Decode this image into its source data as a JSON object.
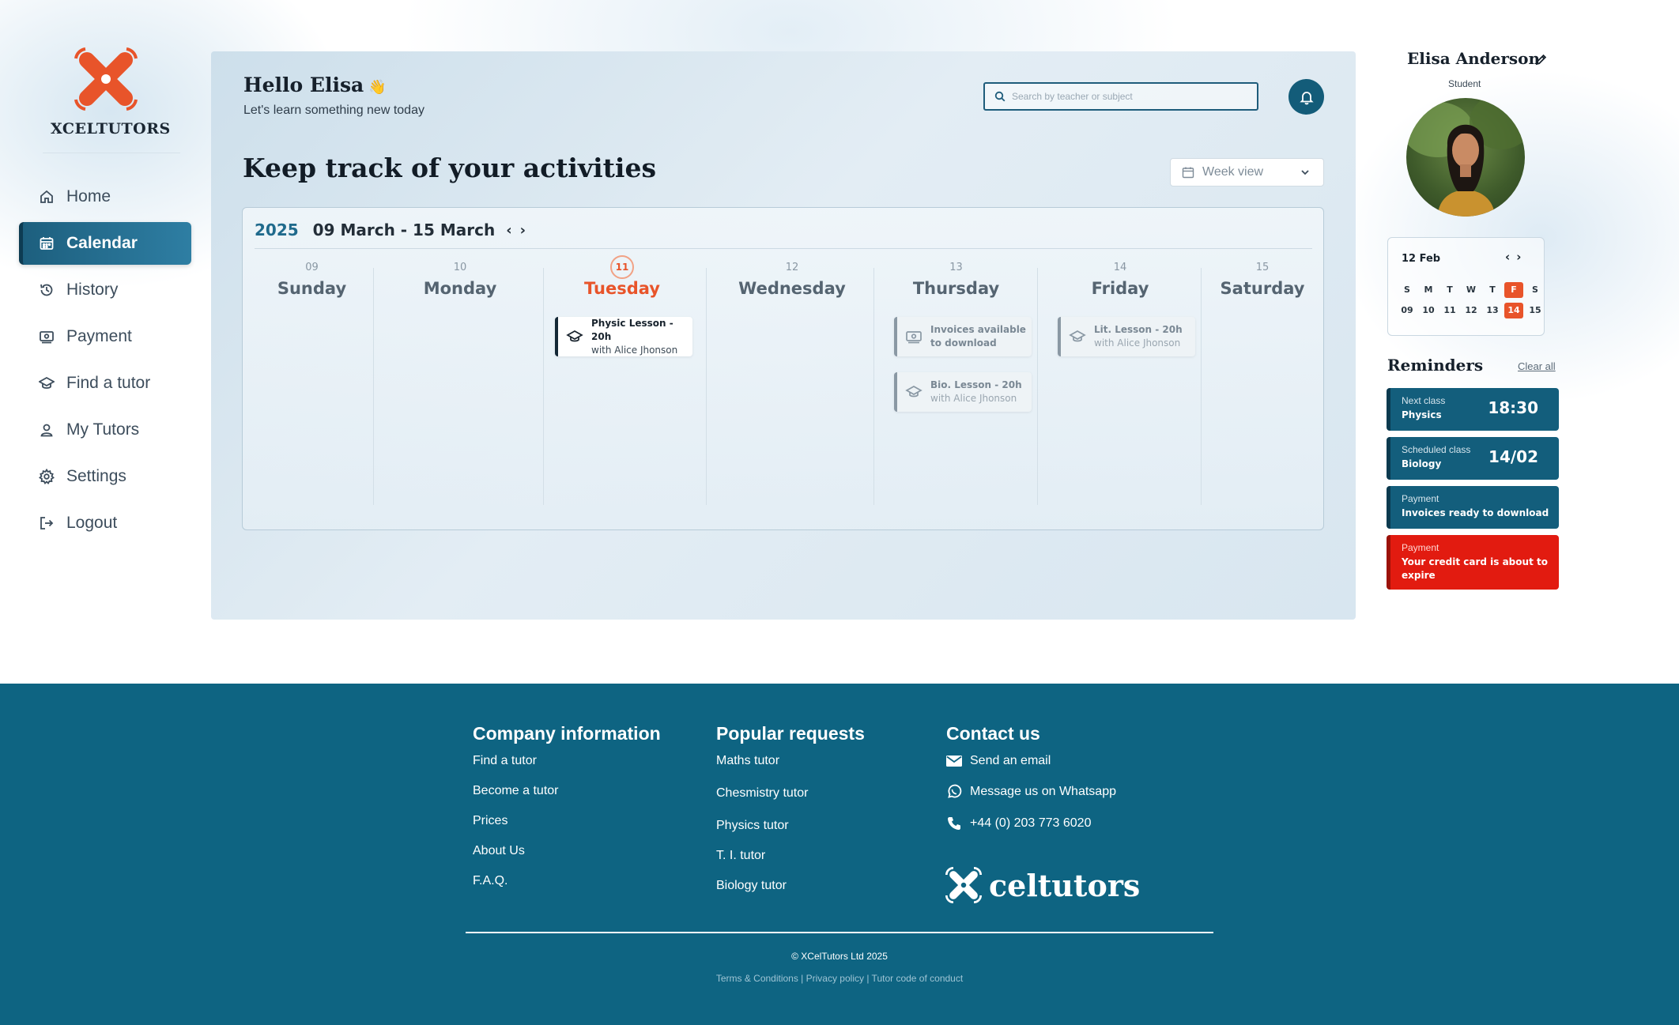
{
  "brand": {
    "name": "XCELTUTORS",
    "accent": "#e8542a",
    "primary": "#135e7c"
  },
  "sidebar": {
    "items": [
      {
        "label": "Home",
        "icon": "home-icon"
      },
      {
        "label": "Calendar",
        "icon": "calendar-icon",
        "active": true
      },
      {
        "label": "History",
        "icon": "history-icon"
      },
      {
        "label": "Payment",
        "icon": "payment-icon"
      },
      {
        "label": "Find a tutor",
        "icon": "graduation-cap-icon"
      },
      {
        "label": "My Tutors",
        "icon": "user-icon"
      },
      {
        "label": "Settings",
        "icon": "gear-icon"
      },
      {
        "label": "Logout",
        "icon": "logout-icon"
      }
    ]
  },
  "header": {
    "greeting": "Hello Elisa",
    "greeting_emoji": "👋",
    "subtitle": "Let's learn something new today",
    "search_placeholder": "Search by teacher or subject"
  },
  "main": {
    "title": "Keep track of your activities",
    "view_select": "Week view"
  },
  "calendar": {
    "year": "2025",
    "range": "09 March - 15 March",
    "days": [
      {
        "num": "09",
        "name": "Sunday"
      },
      {
        "num": "10",
        "name": "Monday"
      },
      {
        "num": "11",
        "name": "Tuesday",
        "today": true
      },
      {
        "num": "12",
        "name": "Wednesday"
      },
      {
        "num": "13",
        "name": "Thursday"
      },
      {
        "num": "14",
        "name": "Friday"
      },
      {
        "num": "15",
        "name": "Saturday"
      }
    ],
    "events": [
      {
        "title": "Physic Lesson - 20h",
        "sub": "with Alice Jhonson",
        "day": "Tuesday"
      },
      {
        "title": "Invoices available",
        "sub": "to download",
        "day": "Thursday"
      },
      {
        "title": "Bio. Lesson - 20h",
        "sub": "with Alice Jhonson",
        "day": "Thursday"
      },
      {
        "title": "Lit. Lesson - 20h",
        "sub": "with Alice Jhonson",
        "day": "Friday"
      }
    ]
  },
  "profile": {
    "name": "Elisa Anderson",
    "role": "Student"
  },
  "mini_calendar": {
    "title": "12 Feb",
    "weekdays": [
      "S",
      "M",
      "T",
      "W",
      "T",
      "F",
      "S"
    ],
    "dates": [
      "09",
      "10",
      "11",
      "12",
      "13",
      "14",
      "15"
    ],
    "highlight_index": 5
  },
  "reminders": {
    "title": "Reminders",
    "clear_label": "Clear all",
    "items": [
      {
        "label": "Next class",
        "text": "Physics",
        "value": "18:30"
      },
      {
        "label": "Scheduled class",
        "text": "Biology",
        "value": "14/02"
      },
      {
        "label": "Payment",
        "text": "Invoices ready to download",
        "value": ""
      },
      {
        "label": "Payment",
        "text": "Your credit card is about to expire",
        "value": "",
        "color": "#e21b10"
      }
    ]
  },
  "footer": {
    "company": {
      "title": "Company information",
      "links": [
        "Find a tutor",
        "Become a tutor",
        "Prices",
        "About Us",
        "F.A.Q."
      ]
    },
    "popular": {
      "title": "Popular requests",
      "links": [
        "Maths tutor",
        "Chesmistry tutor",
        "Physics tutor",
        "T. I. tutor",
        "Biology tutor"
      ]
    },
    "contact": {
      "title": "Contact us",
      "email": "Send an email",
      "whatsapp": "Message us on Whatsapp",
      "phone": "+44 (0) 203 773 6020"
    },
    "logo_text": "celtutors",
    "copyright": "© XCelTutors Ltd 2025",
    "legal": "Terms & Conditions | Privacy policy | Tutor code of conduct"
  }
}
